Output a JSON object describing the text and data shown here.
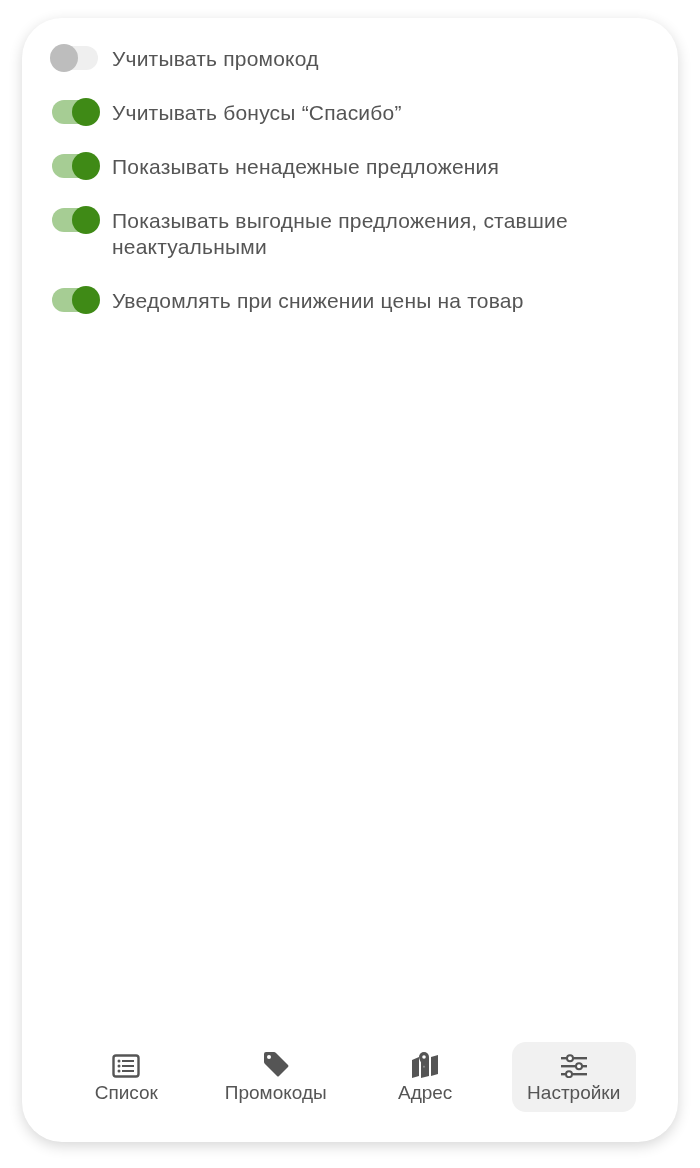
{
  "settings": [
    {
      "label": "Учитывать промокод",
      "on": false
    },
    {
      "label": "Учитывать бонусы “Спасибо”",
      "on": true
    },
    {
      "label": "Показывать ненадежные предложения",
      "on": true
    },
    {
      "label": "Показывать выгодные предложения, ставшие неактуальными",
      "on": true
    },
    {
      "label": "Уведомлять при снижении цены на товар",
      "on": true
    }
  ],
  "tabs": [
    {
      "label": "Список",
      "selected": false
    },
    {
      "label": "Промокоды",
      "selected": false
    },
    {
      "label": "Адрес",
      "selected": false
    },
    {
      "label": "Настройки",
      "selected": true
    }
  ]
}
